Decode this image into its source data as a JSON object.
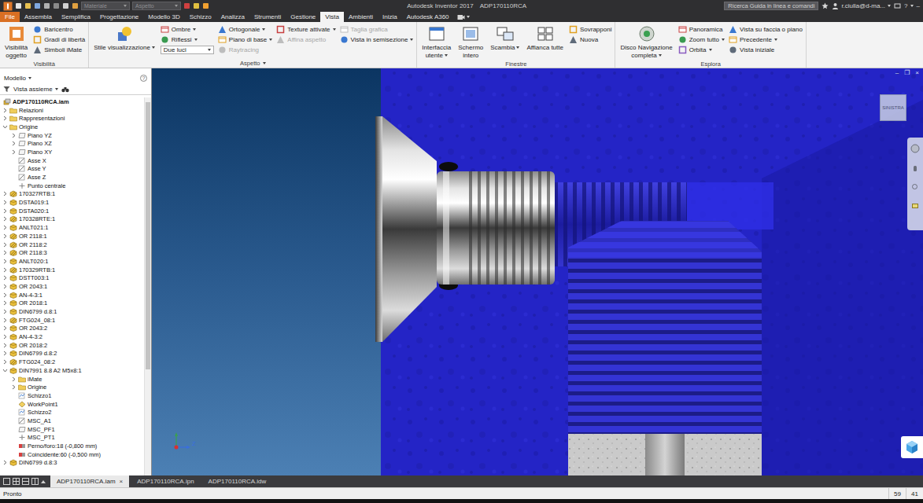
{
  "window": {
    "title": "Autodesk Inventor 2017",
    "document": "ADP170110RCA",
    "controls": [
      "–"
    ]
  },
  "quick_access": {
    "fields": [
      {
        "value": "Materiale"
      },
      {
        "value": "Aspetto"
      }
    ]
  },
  "search": {
    "placeholder": "Ricerca Guida in linea e comandi"
  },
  "user": {
    "name": "r.ciulla@d-ma..."
  },
  "help": "?",
  "tabs": [
    {
      "label": "File",
      "selected": false,
      "kind": "application"
    },
    {
      "label": "Assembla",
      "selected": false,
      "kind": "tab"
    },
    {
      "label": "Semplifica",
      "selected": false,
      "kind": "tab"
    },
    {
      "label": "Progettazione",
      "selected": false,
      "kind": "tab"
    },
    {
      "label": "Modello 3D",
      "selected": false,
      "kind": "tab"
    },
    {
      "label": "Schizzo",
      "selected": false,
      "kind": "tab"
    },
    {
      "label": "Analizza",
      "selected": false,
      "kind": "tab"
    },
    {
      "label": "Strumenti",
      "selected": false,
      "kind": "tab"
    },
    {
      "label": "Gestione",
      "selected": false,
      "kind": "tab"
    },
    {
      "label": "Vista",
      "selected": true,
      "kind": "tab"
    },
    {
      "label": "Ambienti",
      "selected": false,
      "kind": "tab"
    },
    {
      "label": "Inizia",
      "selected": false,
      "kind": "tab"
    },
    {
      "label": "Autodesk A360",
      "selected": false,
      "kind": "tab"
    }
  ],
  "ribbon": {
    "groups": [
      {
        "label": "Visibilità",
        "menu": false,
        "columns": [
          {
            "kind": "large",
            "items": [
              {
                "lines": [
                  "Visibilità",
                  "oggetto"
                ],
                "dropdown": false,
                "disabled": false
              }
            ]
          },
          {
            "kind": "small",
            "items": [
              {
                "label": "Baricentro",
                "kind": "button",
                "dropdown": false,
                "disabled": false
              },
              {
                "label": "Gradi di libertà",
                "kind": "button",
                "dropdown": false,
                "disabled": false
              },
              {
                "label": "Simboli iMate",
                "kind": "button",
                "dropdown": false,
                "disabled": false
              }
            ]
          }
        ]
      },
      {
        "label": "Aspetto",
        "menu": true,
        "columns": [
          {
            "kind": "large",
            "items": [
              {
                "lines": [
                  "Stile visualizzazione"
                ],
                "dropdown": true,
                "disabled": false
              }
            ]
          },
          {
            "kind": "small",
            "items": [
              {
                "label": "Ombre",
                "kind": "button",
                "dropdown": true,
                "disabled": false
              },
              {
                "label": "Riflessi",
                "kind": "button",
                "dropdown": true,
                "disabled": false
              },
              {
                "label": "Due luci",
                "kind": "select",
                "dropdown": true,
                "disabled": false
              }
            ]
          },
          {
            "kind": "small",
            "items": [
              {
                "label": "Ortogonale",
                "kind": "button",
                "dropdown": true,
                "disabled": false
              },
              {
                "label": "Piano di base",
                "kind": "button",
                "dropdown": true,
                "disabled": false
              },
              {
                "label": "Raytracing",
                "kind": "button",
                "dropdown": false,
                "disabled": true
              }
            ]
          },
          {
            "kind": "small",
            "items": [
              {
                "label": "Texture attivate",
                "kind": "button",
                "dropdown": true,
                "disabled": false
              },
              {
                "label": "Affina aspetto",
                "kind": "button",
                "dropdown": false,
                "disabled": true
              }
            ]
          },
          {
            "kind": "small",
            "items": [
              {
                "label": "Taglia grafica",
                "kind": "button",
                "dropdown": false,
                "disabled": true
              },
              {
                "label": "Vista in semisezione",
                "kind": "button",
                "dropdown": true,
                "disabled": false
              }
            ]
          }
        ]
      },
      {
        "label": "Finestre",
        "menu": false,
        "columns": [
          {
            "kind": "large",
            "items": [
              {
                "lines": [
                  "Interfaccia",
                  "utente"
                ],
                "dropdown": true,
                "disabled": false
              }
            ]
          },
          {
            "kind": "large",
            "items": [
              {
                "lines": [
                  "Schermo",
                  "intero"
                ],
                "dropdown": false,
                "disabled": false
              }
            ]
          },
          {
            "kind": "large",
            "items": [
              {
                "lines": [
                  "Scambia"
                ],
                "dropdown": true,
                "disabled": false
              }
            ]
          },
          {
            "kind": "large",
            "items": [
              {
                "lines": [
                  "Affianca tutte"
                ],
                "dropdown": false,
                "disabled": false
              }
            ]
          },
          {
            "kind": "small",
            "items": [
              {
                "label": "Sovrapponi",
                "kind": "button",
                "dropdown": false,
                "disabled": false
              },
              {
                "label": "Nuova",
                "kind": "button",
                "dropdown": false,
                "disabled": false
              }
            ]
          }
        ]
      },
      {
        "label": "Esplora",
        "menu": false,
        "columns": [
          {
            "kind": "large",
            "items": [
              {
                "lines": [
                  "Disco Navigazione",
                  "completa"
                ],
                "dropdown": true,
                "disabled": false
              }
            ]
          },
          {
            "kind": "small",
            "items": [
              {
                "label": "Panoramica",
                "kind": "button",
                "dropdown": false,
                "disabled": false
              },
              {
                "label": "Zoom tutto",
                "kind": "button",
                "dropdown": true,
                "disabled": false
              },
              {
                "label": "Orbita",
                "kind": "button",
                "dropdown": true,
                "disabled": false
              }
            ]
          },
          {
            "kind": "small",
            "items": [
              {
                "label": "Vista su faccia o piano",
                "kind": "button",
                "dropdown": false,
                "disabled": false
              },
              {
                "label": "Precedente",
                "kind": "button",
                "dropdown": true,
                "disabled": false
              },
              {
                "label": "Vista iniziale",
                "kind": "button",
                "dropdown": false,
                "disabled": false
              }
            ]
          }
        ]
      }
    ]
  },
  "browser": {
    "title": "Modello",
    "view": "Vista assieme",
    "help": "?",
    "tree": [
      {
        "label": "ADP170110RCA.iam",
        "depth": 0,
        "kind": "assembly",
        "expandable": false,
        "expanded": false,
        "bold": true
      },
      {
        "label": "Relazioni",
        "depth": 1,
        "kind": "folder",
        "expandable": true,
        "expanded": false,
        "bold": false
      },
      {
        "label": "Rappresentazioni",
        "depth": 1,
        "kind": "folder",
        "expandable": true,
        "expanded": false,
        "bold": false
      },
      {
        "label": "Origine",
        "depth": 1,
        "kind": "folder",
        "expandable": true,
        "expanded": true,
        "bold": false
      },
      {
        "label": "Piano YZ",
        "depth": 2,
        "kind": "plane",
        "expandable": true,
        "expanded": false,
        "bold": false
      },
      {
        "label": "Piano XZ",
        "depth": 2,
        "kind": "plane",
        "expandable": true,
        "expanded": false,
        "bold": false
      },
      {
        "label": "Piano XY",
        "depth": 2,
        "kind": "plane",
        "expandable": true,
        "expanded": false,
        "bold": false
      },
      {
        "label": "Asse X",
        "depth": 2,
        "kind": "axis",
        "expandable": false,
        "expanded": false,
        "bold": false
      },
      {
        "label": "Asse Y",
        "depth": 2,
        "kind": "axis",
        "expandable": false,
        "expanded": false,
        "bold": false
      },
      {
        "label": "Asse Z",
        "depth": 2,
        "kind": "axis",
        "expandable": false,
        "expanded": false,
        "bold": false
      },
      {
        "label": "Punto centrale",
        "depth": 2,
        "kind": "point",
        "expandable": false,
        "expanded": false,
        "bold": false
      },
      {
        "label": "170327RTB:1",
        "depth": 1,
        "kind": "subassembly",
        "expandable": true,
        "expanded": false,
        "bold": false
      },
      {
        "label": "DSTA019:1",
        "depth": 1,
        "kind": "part",
        "expandable": true,
        "expanded": false,
        "bold": false
      },
      {
        "label": "DSTA020:1",
        "depth": 1,
        "kind": "part",
        "expandable": true,
        "expanded": false,
        "bold": false
      },
      {
        "label": "170328RTE:1",
        "depth": 1,
        "kind": "subassembly",
        "expandable": true,
        "expanded": false,
        "bold": false
      },
      {
        "label": "ANLT021:1",
        "depth": 1,
        "kind": "part",
        "expandable": true,
        "expanded": false,
        "bold": false
      },
      {
        "label": "OR 2118:1",
        "depth": 1,
        "kind": "subassembly",
        "expandable": true,
        "expanded": false,
        "bold": false
      },
      {
        "label": "OR 2118:2",
        "depth": 1,
        "kind": "subassembly",
        "expandable": true,
        "expanded": false,
        "bold": false
      },
      {
        "label": "OR 2118:3",
        "depth": 1,
        "kind": "subassembly",
        "expandable": true,
        "expanded": false,
        "bold": false
      },
      {
        "label": "ANLT020:1",
        "depth": 1,
        "kind": "part",
        "expandable": true,
        "expanded": false,
        "bold": false
      },
      {
        "label": "170329RTB:1",
        "depth": 1,
        "kind": "subassembly",
        "expandable": true,
        "expanded": false,
        "bold": false
      },
      {
        "label": "DSTT003:1",
        "depth": 1,
        "kind": "part",
        "expandable": true,
        "expanded": false,
        "bold": false
      },
      {
        "label": "OR 2043:1",
        "depth": 1,
        "kind": "part",
        "expandable": true,
        "expanded": false,
        "bold": false
      },
      {
        "label": "AN-4-3:1",
        "depth": 1,
        "kind": "part",
        "expandable": true,
        "expanded": false,
        "bold": false
      },
      {
        "label": "OR 2018:1",
        "depth": 1,
        "kind": "part",
        "expandable": true,
        "expanded": false,
        "bold": false
      },
      {
        "label": "DIN6799 d.8:1",
        "depth": 1,
        "kind": "part",
        "expandable": true,
        "expanded": false,
        "bold": false
      },
      {
        "label": "FTG024_08:1",
        "depth": 1,
        "kind": "subassembly",
        "expandable": true,
        "expanded": false,
        "bold": false
      },
      {
        "label": "OR 2043:2",
        "depth": 1,
        "kind": "part",
        "expandable": true,
        "expanded": false,
        "bold": false
      },
      {
        "label": "AN-4-3:2",
        "depth": 1,
        "kind": "part",
        "expandable": true,
        "expanded": false,
        "bold": false
      },
      {
        "label": "OR 2018:2",
        "depth": 1,
        "kind": "part",
        "expandable": true,
        "expanded": false,
        "bold": false
      },
      {
        "label": "DIN6799 d.8:2",
        "depth": 1,
        "kind": "part",
        "expandable": true,
        "expanded": false,
        "bold": false
      },
      {
        "label": "FTG024_08:2",
        "depth": 1,
        "kind": "subassembly",
        "expandable": true,
        "expanded": false,
        "bold": false
      },
      {
        "label": "DIN7991 8.8 A2 M5x8:1",
        "depth": 1,
        "kind": "part",
        "expandable": true,
        "expanded": true,
        "bold": false
      },
      {
        "label": "iMate",
        "depth": 2,
        "kind": "folder",
        "expandable": true,
        "expanded": false,
        "bold": false
      },
      {
        "label": "Origine",
        "depth": 2,
        "kind": "folder",
        "expandable": true,
        "expanded": false,
        "bold": false
      },
      {
        "label": "Schizzo1",
        "depth": 2,
        "kind": "sketch",
        "expandable": false,
        "expanded": false,
        "bold": false
      },
      {
        "label": "WorkPoint1",
        "depth": 2,
        "kind": "workpoint",
        "expandable": false,
        "expanded": false,
        "bold": false
      },
      {
        "label": "Schizzo2",
        "depth": 2,
        "kind": "sketch",
        "expandable": false,
        "expanded": false,
        "bold": false
      },
      {
        "label": "MSC_A1",
        "depth": 2,
        "kind": "axis",
        "expandable": false,
        "expanded": false,
        "bold": false
      },
      {
        "label": "MSC_PF1",
        "depth": 2,
        "kind": "plane",
        "expandable": false,
        "expanded": false,
        "bold": false
      },
      {
        "label": "MSC_PT1",
        "depth": 2,
        "kind": "point",
        "expandable": false,
        "expanded": false,
        "bold": false
      },
      {
        "label": "Perno/foro:18 (-0,800 mm)",
        "depth": 2,
        "kind": "constraint",
        "expandable": false,
        "expanded": false,
        "bold": false
      },
      {
        "label": "Coincidente:60 (-0,500 mm)",
        "depth": 2,
        "kind": "constraint",
        "expandable": false,
        "expanded": false,
        "bold": false
      },
      {
        "label": "DIN6799 d.8:3",
        "depth": 1,
        "kind": "part",
        "expandable": true,
        "expanded": false,
        "bold": false
      }
    ]
  },
  "viewport": {
    "viewcube": "SINISTRA",
    "axis": "Z",
    "window_controls": [
      "–",
      "❐",
      "×"
    ]
  },
  "doc_tabs": {
    "close": "×",
    "tabs": [
      {
        "label": "ADP170110RCA.iam",
        "selected": true,
        "closable": true
      },
      {
        "label": "ADP170110RCA.ipn",
        "selected": false,
        "closable": false
      },
      {
        "label": "ADP170110RCA.idw",
        "selected": false,
        "closable": false
      }
    ]
  },
  "status": {
    "text": "Pronto",
    "values": [
      "59",
      "41"
    ]
  }
}
